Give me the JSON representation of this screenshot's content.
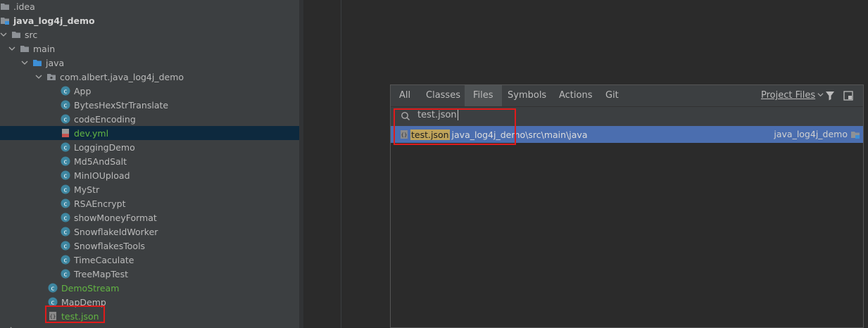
{
  "project_tree": {
    "items": [
      {
        "label": "idea_folder",
        "text": ".idea",
        "top": -1
      },
      {
        "text": "java_log4j_demo"
      },
      {
        "text": "src"
      },
      {
        "text": "main"
      },
      {
        "text": "java"
      },
      {
        "text": "com.albert.java_log4j_demo"
      },
      {
        "text": "App"
      },
      {
        "text": "BytesHexStrTranslate"
      },
      {
        "text": "codeEncoding"
      },
      {
        "text": "dev.yml"
      },
      {
        "text": "LoggingDemo"
      },
      {
        "text": "Md5AndSalt"
      },
      {
        "text": "MinIOUpload"
      },
      {
        "text": "MyStr"
      },
      {
        "text": "RSAEncrypt"
      },
      {
        "text": "showMoneyFormat"
      },
      {
        "text": "SnowflakeIdWorker"
      },
      {
        "text": "SnowflakesTools"
      },
      {
        "text": "TimeCaculate"
      },
      {
        "text": "TreeMapTest"
      },
      {
        "text": "DemoStream"
      },
      {
        "text": "MapDemp"
      },
      {
        "text": "test.json"
      }
    ]
  },
  "search_popup": {
    "tabs": [
      "All",
      "Classes",
      "Files",
      "Symbols",
      "Actions",
      "Git"
    ],
    "active_tab": "Files",
    "scope_filter": "Project Files",
    "query": "test.json",
    "results": [
      {
        "match": "test.json",
        "path": "java_log4j_demo\\src\\main\\java",
        "module": "java_log4j_demo"
      }
    ]
  },
  "colors": {
    "highlight_box": "#e01b1b",
    "selected_result": "#4b6eaf",
    "match_highlight": "#bfa35a",
    "java_class_icon": "#3e86a0"
  }
}
